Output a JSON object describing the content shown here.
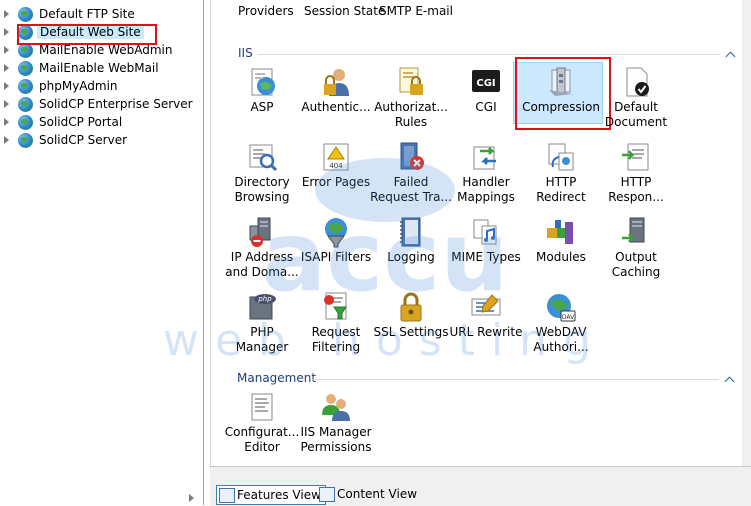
{
  "tree": {
    "items": [
      {
        "label": "Default FTP Site"
      },
      {
        "label": "Default Web Site"
      },
      {
        "label": "MailEnable WebAdmin"
      },
      {
        "label": "MailEnable WebMail"
      },
      {
        "label": "phpMyAdmin"
      },
      {
        "label": "SolidCP Enterprise Server"
      },
      {
        "label": "SolidCP Portal"
      },
      {
        "label": "SolidCP Server"
      }
    ],
    "selected": "Default Web Site"
  },
  "top_row": {
    "labels": [
      "Providers",
      "Session State",
      "SMTP E-mail"
    ]
  },
  "groups": {
    "iis": {
      "title": "IIS",
      "features": [
        {
          "label1": "ASP",
          "label2": "",
          "icon": "asp-icon"
        },
        {
          "label1": "Authentic...",
          "label2": "",
          "icon": "authentication-icon"
        },
        {
          "label1": "Authorizat...",
          "label2": "Rules",
          "icon": "authorization-rules-icon"
        },
        {
          "label1": "CGI",
          "label2": "",
          "icon": "cgi-icon"
        },
        {
          "label1": "Compression",
          "label2": "",
          "icon": "compression-icon"
        },
        {
          "label1": "Default",
          "label2": "Document",
          "icon": "default-document-icon"
        },
        {
          "label1": "Directory",
          "label2": "Browsing",
          "icon": "directory-browsing-icon"
        },
        {
          "label1": "Error Pages",
          "label2": "",
          "icon": "error-pages-icon"
        },
        {
          "label1": "Failed",
          "label2": "Request Tra...",
          "icon": "failed-request-tracing-icon"
        },
        {
          "label1": "Handler",
          "label2": "Mappings",
          "icon": "handler-mappings-icon"
        },
        {
          "label1": "HTTP",
          "label2": "Redirect",
          "icon": "http-redirect-icon"
        },
        {
          "label1": "HTTP",
          "label2": "Respon...",
          "icon": "http-response-headers-icon"
        },
        {
          "label1": "IP Address",
          "label2": "and Doma...",
          "icon": "ip-address-domain-icon"
        },
        {
          "label1": "ISAPI Filters",
          "label2": "",
          "icon": "isapi-filters-icon"
        },
        {
          "label1": "Logging",
          "label2": "",
          "icon": "logging-icon"
        },
        {
          "label1": "MIME Types",
          "label2": "",
          "icon": "mime-types-icon"
        },
        {
          "label1": "Modules",
          "label2": "",
          "icon": "modules-icon"
        },
        {
          "label1": "Output",
          "label2": "Caching",
          "icon": "output-caching-icon"
        },
        {
          "label1": "PHP",
          "label2": "Manager",
          "icon": "php-manager-icon"
        },
        {
          "label1": "Request",
          "label2": "Filtering",
          "icon": "request-filtering-icon"
        },
        {
          "label1": "SSL Settings",
          "label2": "",
          "icon": "ssl-settings-icon"
        },
        {
          "label1": "URL Rewrite",
          "label2": "",
          "icon": "url-rewrite-icon"
        },
        {
          "label1": "WebDAV",
          "label2": "Authori...",
          "icon": "webdav-authoring-icon"
        }
      ],
      "cgi_text": "CGI",
      "error_text": "404",
      "php_text": "php",
      "dav_text": "DAV"
    },
    "management": {
      "title": "Management",
      "features": [
        {
          "label1": "Configurat...",
          "label2": "Editor",
          "icon": "configuration-editor-icon"
        },
        {
          "label1": "IIS Manager",
          "label2": "Permissions",
          "icon": "iis-manager-permissions-icon"
        }
      ]
    }
  },
  "bottom_bar": {
    "features_view": "Features View",
    "content_view": "Content View"
  },
  "watermark": {
    "line1": "accu",
    "line2": "web hosting"
  },
  "colors": {
    "selection": "#cce8ff",
    "red_highlight": "#e0101a",
    "group_title": "#1e3f7a"
  }
}
